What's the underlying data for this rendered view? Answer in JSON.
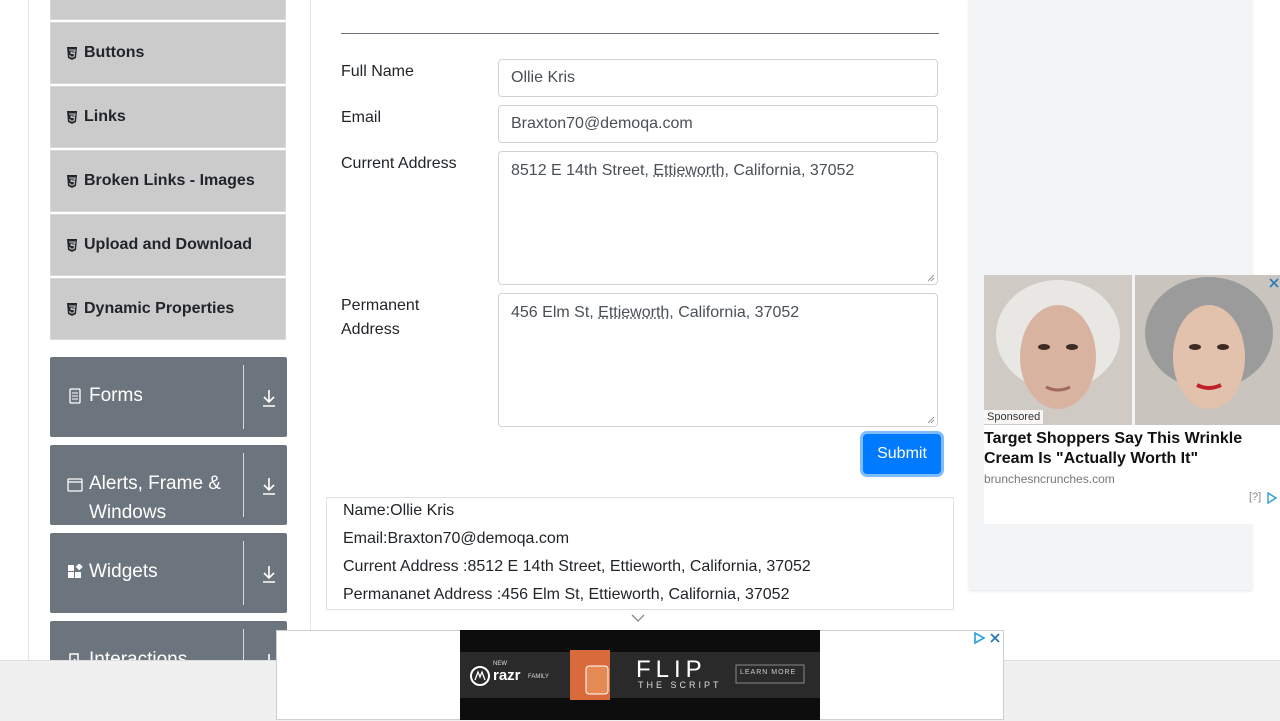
{
  "sidebar": {
    "subitems": [
      {
        "label": "Buttons"
      },
      {
        "label": "Links"
      },
      {
        "label": "Broken Links - Images"
      },
      {
        "label": "Upload and Download"
      },
      {
        "label": "Dynamic Properties"
      }
    ],
    "groups": [
      {
        "title": "Forms",
        "icon": "document-icon"
      },
      {
        "title_line1": "Alerts, Frame &",
        "title_line2": "Windows",
        "icon": "window-icon"
      },
      {
        "title": "Widgets",
        "icon": "widgets-icon"
      },
      {
        "title": "Interactions",
        "icon": "interactions-icon"
      }
    ]
  },
  "form": {
    "full_name_label": "Full Name",
    "full_name_value": "Ollie Kris",
    "email_label": "Email",
    "email_value": "Braxton70@demoqa.com",
    "current_address_label": "Current Address",
    "current_address_value_pre": "8512 E 14th Street, ",
    "current_address_value_city": "Ettieworth",
    "current_address_value_post": ", California, 37052",
    "permanent_address_label_line1": "Permanent",
    "permanent_address_label_line2": "Address",
    "permanent_address_value_pre": "456 Elm St, ",
    "permanent_address_value_city": "Ettieworth",
    "permanent_address_value_post": ", California, 37052",
    "submit_label": "Submit"
  },
  "output": {
    "name": "Name:Ollie Kris",
    "email": "Email:Braxton70@demoqa.com",
    "current_address": "Current Address :8512 E 14th Street, Ettieworth, California, 37052",
    "permanent_address": "Permananet Address :456 Elm St, Ettieworth, California, 37052"
  },
  "ad": {
    "sponsored": "Sponsored",
    "headline": "Target Shoppers Say This Wrinkle Cream Is \"Actually Worth It\"",
    "domain": "brunchesncrunches.com",
    "help": "[?]"
  },
  "banner": {
    "brand": "razr",
    "brand_small": "NEW",
    "family": "FAMILY",
    "product": "FLIP",
    "product_mirror": "THE SCRIPT",
    "cta": "LEARN MORE"
  },
  "colors": {
    "primary": "#007bff",
    "sidebar_group": "#6c757d",
    "sidebar_item": "#cbcbcb"
  }
}
